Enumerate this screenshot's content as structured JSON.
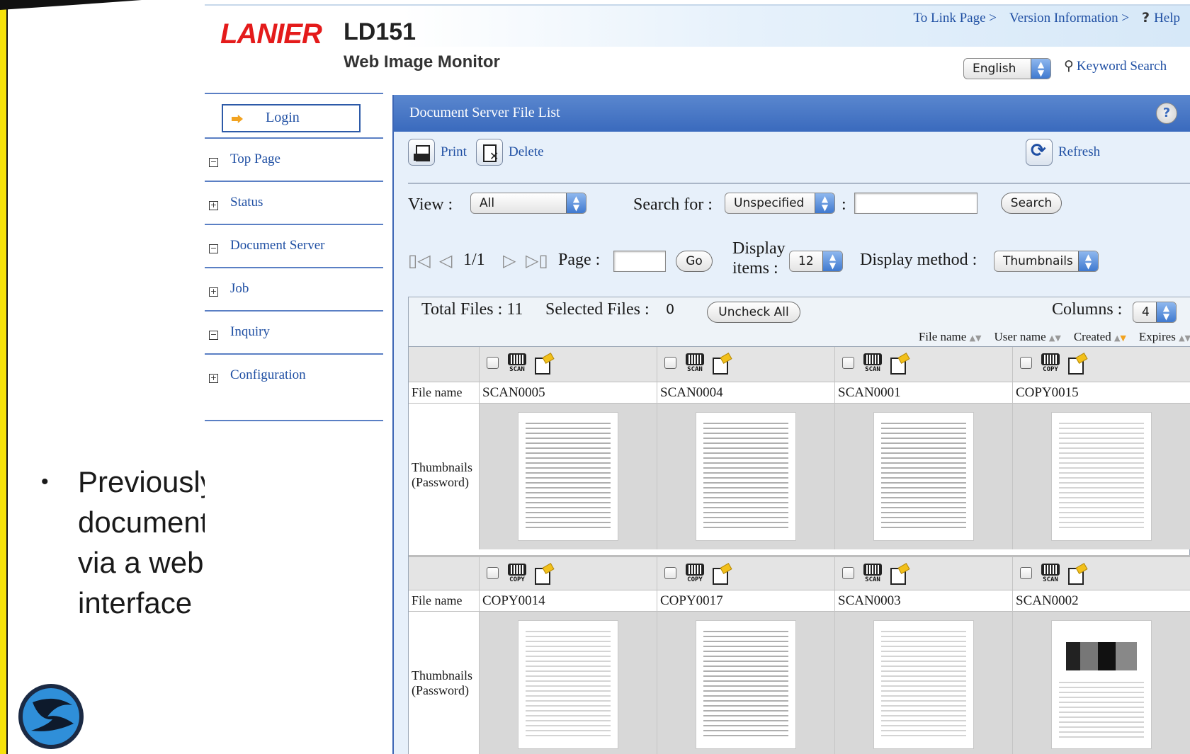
{
  "slide": {
    "bullet_text": "Previously copied document available via a web based interface",
    "bullet_symbol": "•",
    "accent_color": "#f6e20a"
  },
  "header": {
    "brand": "LANIER",
    "brand_color": "#e41b1b",
    "product": "LD151",
    "subtitle": "Web Image Monitor",
    "links": [
      "To Link Page >",
      "Version Information >",
      "Help"
    ],
    "language": "English",
    "keyword_search": "Keyword Search"
  },
  "nav": {
    "login": "Login",
    "items": [
      {
        "label": "Top Page",
        "expander": "−"
      },
      {
        "label": "Status",
        "expander": "+"
      },
      {
        "label": "Document Server",
        "expander": "−"
      },
      {
        "label": "Job",
        "expander": "+"
      },
      {
        "label": "Inquiry",
        "expander": "−"
      },
      {
        "label": "Configuration",
        "expander": "+"
      }
    ]
  },
  "panel": {
    "title": "Document Server File List",
    "help": "?",
    "toolbar": {
      "print": "Print",
      "delete": "Delete",
      "refresh": "Refresh"
    },
    "view_label": "View :",
    "view_value": "All",
    "search_for_label": "Search for :",
    "search_for_value": "Unspecified",
    "colon": ":",
    "search_button": "Search",
    "pager": {
      "first": "▯◁",
      "prev": "◁",
      "position": "1/1",
      "next": "▷",
      "last": "▷▯"
    },
    "page_label": "Page :",
    "go_button": "Go",
    "display_items_label_1": "Display",
    "display_items_label_2": "items :",
    "display_items_value": "12",
    "display_method_label": "Display method :",
    "display_method_value": "Thumbnails"
  },
  "files": {
    "total_label": "Total Files : 11",
    "selected_label": "Selected Files :",
    "selected_count": "0",
    "uncheck_all": "Uncheck All",
    "columns_label": "Columns :",
    "columns_value": "4",
    "sort": [
      "File name",
      "User name",
      "Created",
      "Expires"
    ],
    "row_labels": {
      "name": "File name",
      "thumb_1": "Thumbnails",
      "thumb_2": "(Password)"
    },
    "rows": [
      [
        {
          "name": "SCAN0005",
          "type": "SCAN"
        },
        {
          "name": "SCAN0004",
          "type": "SCAN"
        },
        {
          "name": "SCAN0001",
          "type": "SCAN"
        },
        {
          "name": "COPY0015",
          "type": "COPY"
        }
      ],
      [
        {
          "name": "COPY0014",
          "type": "COPY"
        },
        {
          "name": "COPY0017",
          "type": "COPY"
        },
        {
          "name": "SCAN0003",
          "type": "SCAN"
        },
        {
          "name": "SCAN0002",
          "type": "SCAN"
        }
      ]
    ]
  }
}
